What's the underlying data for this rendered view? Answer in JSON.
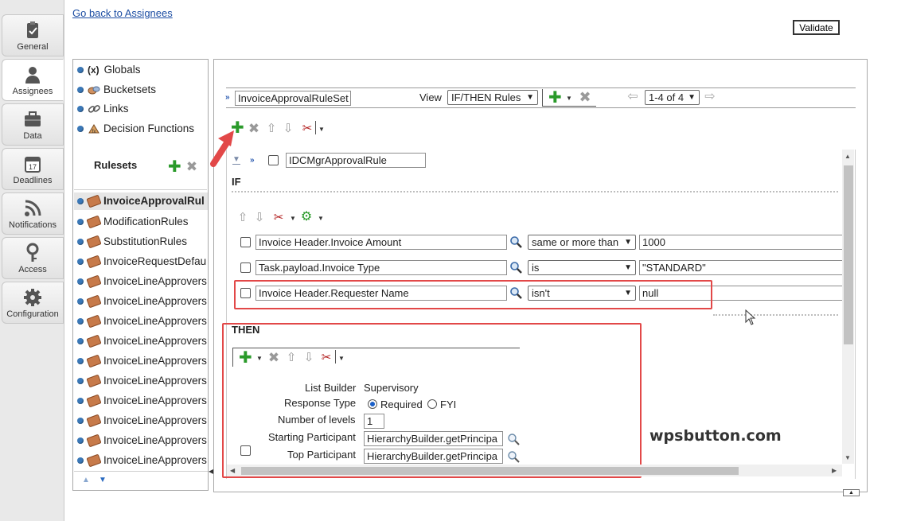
{
  "tabs": [
    {
      "label": "General",
      "icon": "clipboard-icon"
    },
    {
      "label": "Assignees",
      "icon": "person-icon"
    },
    {
      "label": "Data",
      "icon": "briefcase-icon"
    },
    {
      "label": "Deadlines",
      "icon": "calendar-icon"
    },
    {
      "label": "Notifications",
      "icon": "feed-icon"
    },
    {
      "label": "Access",
      "icon": "key-icon"
    },
    {
      "label": "Configuration",
      "icon": "gear-icon"
    }
  ],
  "calendar_day": "17",
  "back_link": "Go back to Assignees",
  "validate_label": "Validate",
  "navigator": {
    "items": [
      "Globals",
      "Bucketsets",
      "Links",
      "Decision Functions"
    ],
    "globals_symbol": "(x)",
    "rulesets_title": "Rulesets",
    "rulesets": [
      "InvoiceApprovalRul",
      "ModificationRules",
      "SubstitutionRules",
      "InvoiceRequestDefau",
      "InvoiceLineApprovers",
      "InvoiceLineApprovers",
      "InvoiceLineApprovers",
      "InvoiceLineApprovers",
      "InvoiceLineApprovers",
      "InvoiceLineApprovers",
      "InvoiceLineApprovers",
      "InvoiceLineApprovers",
      "InvoiceLineApprovers",
      "InvoiceLineApprovers"
    ]
  },
  "ruleset_bar": {
    "name": "InvoiceApprovalRuleSet",
    "view_label": "View",
    "view_value": "IF/THEN Rules",
    "pager_value": "1-4 of 4"
  },
  "rule": {
    "name": "IDCMgrApprovalRule",
    "if_label": "IF",
    "then_label": "THEN",
    "conditions": [
      {
        "left": "Invoice Header.Invoice Amount",
        "op": "same or more than",
        "right": "1000"
      },
      {
        "left": "Task.payload.Invoice Type",
        "op": "is",
        "right": "\"STANDARD\""
      },
      {
        "left": "Invoice Header.Requester Name",
        "op": "isn't",
        "right": "null"
      }
    ],
    "action": {
      "list_builder_label": "List Builder",
      "list_builder_value": "Supervisory",
      "response_type_label": "Response Type",
      "response_required": "Required",
      "response_fyi": "FYI",
      "levels_label": "Number of levels",
      "levels_value": "1",
      "starting_label": "Starting Participant",
      "starting_value": "HierarchyBuilder.getPrincipa",
      "top_label": "Top Participant",
      "top_value": "HierarchyBuilder.getPrincipa"
    }
  },
  "watermark": "wpsbutton.com",
  "colors": {
    "highlight": "#e24848",
    "link": "#1d4ea3",
    "add_green": "#2a9a2a"
  }
}
